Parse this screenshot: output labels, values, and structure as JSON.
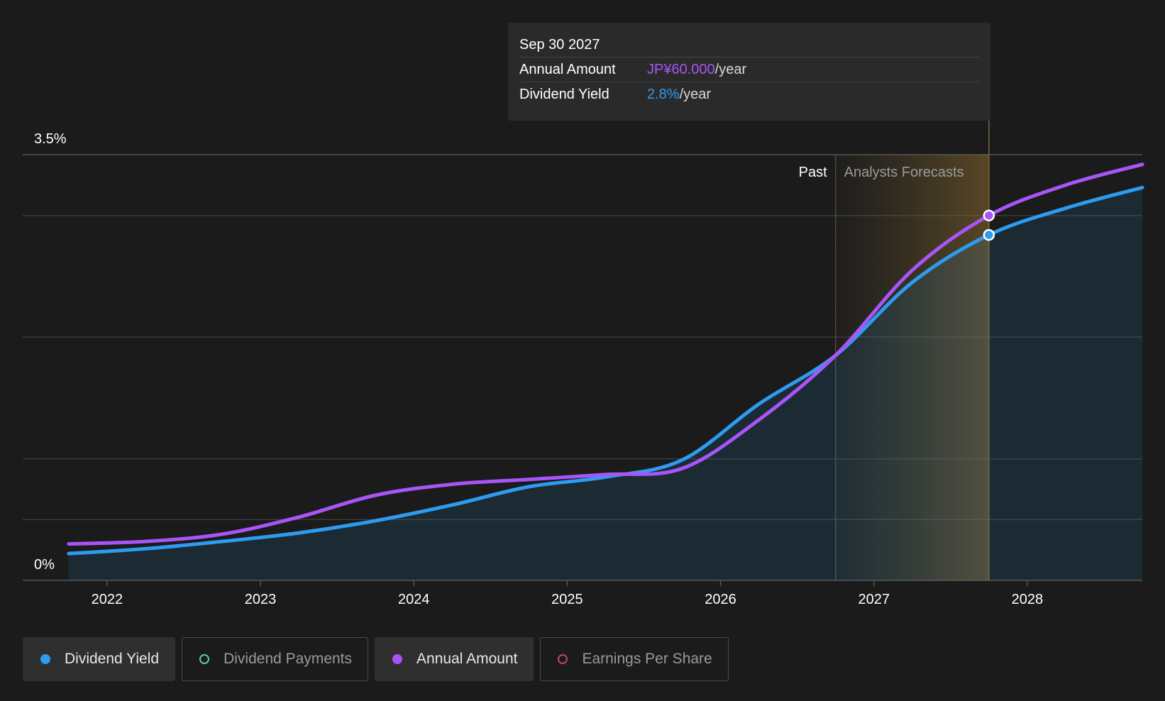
{
  "tooltip": {
    "date": "Sep 30 2027",
    "rows": [
      {
        "label": "Annual Amount",
        "value": "JP¥60.000",
        "unit": "/year"
      },
      {
        "label": "Dividend Yield",
        "value": "2.8%",
        "unit": "/year"
      }
    ]
  },
  "legend": [
    {
      "label": "Dividend Yield",
      "color": "#2d9cf0",
      "active": true
    },
    {
      "label": "Dividend Payments",
      "color": "#5ec8b8",
      "active": false
    },
    {
      "label": "Annual Amount",
      "color": "#a855f7",
      "active": true
    },
    {
      "label": "Earnings Per Share",
      "color": "#c0407a",
      "active": false
    }
  ],
  "chart_data": {
    "type": "line",
    "title": "",
    "xlabel": "",
    "ylabel": "",
    "ylim": [
      0,
      3.5
    ],
    "y_tick_labels": [
      {
        "value": 3.5,
        "label": "3.5%"
      },
      {
        "value": 0,
        "label": "0%"
      }
    ],
    "y_gridlines": [
      0,
      0.5,
      1.0,
      2.0,
      3.0,
      3.5
    ],
    "x_ticks": [
      2022,
      2023,
      2024,
      2025,
      2026,
      2027,
      2028
    ],
    "x_range": [
      2021.45,
      2028.75
    ],
    "region_labels": {
      "past": "Past",
      "forecast": "Analysts Forecasts"
    },
    "forecast_start": 2026.75,
    "highlight_x": 2027.75,
    "series": [
      {
        "name": "Dividend Yield",
        "color": "#2d9cf0",
        "area": true,
        "points": [
          [
            2021.75,
            0.22
          ],
          [
            2022.25,
            0.26
          ],
          [
            2022.75,
            0.32
          ],
          [
            2023.25,
            0.39
          ],
          [
            2023.75,
            0.49
          ],
          [
            2024.25,
            0.62
          ],
          [
            2024.75,
            0.77
          ],
          [
            2025.25,
            0.85
          ],
          [
            2025.75,
            0.99
          ],
          [
            2026.25,
            1.45
          ],
          [
            2026.75,
            1.85
          ],
          [
            2027.25,
            2.45
          ],
          [
            2027.75,
            2.84
          ],
          [
            2028.25,
            3.06
          ],
          [
            2028.75,
            3.23
          ]
        ]
      },
      {
        "name": "Annual Amount",
        "color": "#a855f7",
        "area": false,
        "points": [
          [
            2021.75,
            0.3
          ],
          [
            2022.25,
            0.32
          ],
          [
            2022.75,
            0.38
          ],
          [
            2023.25,
            0.52
          ],
          [
            2023.75,
            0.7
          ],
          [
            2024.25,
            0.79
          ],
          [
            2024.75,
            0.83
          ],
          [
            2025.25,
            0.87
          ],
          [
            2025.75,
            0.92
          ],
          [
            2026.25,
            1.32
          ],
          [
            2026.75,
            1.85
          ],
          [
            2027.25,
            2.55
          ],
          [
            2027.75,
            3.0
          ],
          [
            2028.25,
            3.25
          ],
          [
            2028.75,
            3.42
          ]
        ]
      }
    ]
  }
}
